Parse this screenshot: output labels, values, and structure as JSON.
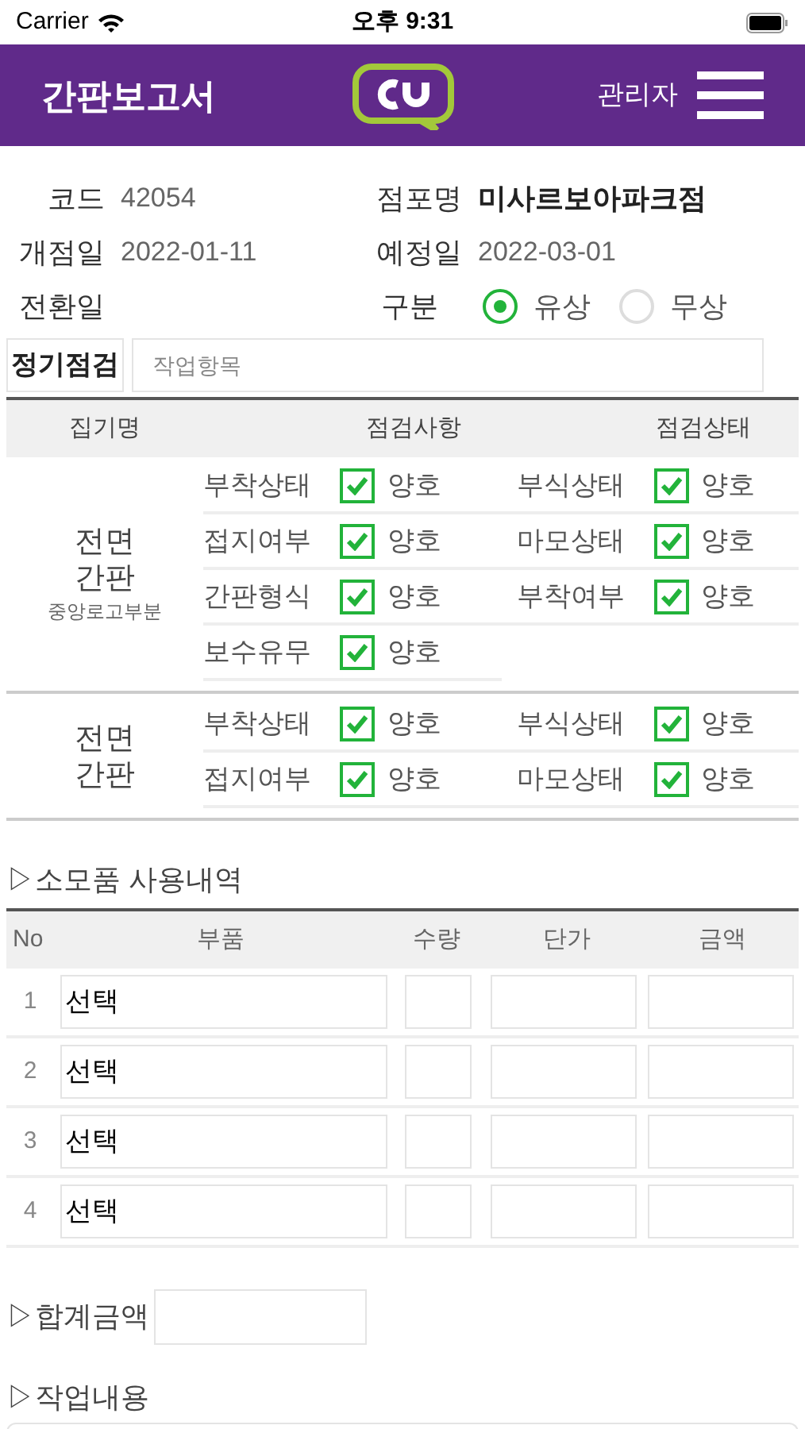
{
  "status_bar": {
    "carrier": "Carrier",
    "time": "오후 9:31"
  },
  "header": {
    "title": "간판보고서",
    "user": "관리자"
  },
  "info": {
    "code": {
      "label": "코드",
      "value": "42054"
    },
    "store": {
      "label": "점포명",
      "value": "미사르보아파크점"
    },
    "open_date": {
      "label": "개점일",
      "value": "2022-01-11"
    },
    "planned_date": {
      "label": "예정일",
      "value": "2022-03-01"
    },
    "conversion_date": {
      "label": "전환일"
    },
    "type": {
      "label": "구분",
      "options": [
        {
          "label": "유상",
          "selected": true
        },
        {
          "label": "무상",
          "selected": false
        }
      ]
    }
  },
  "regular": {
    "button": "정기점검",
    "placeholder": "작업항목"
  },
  "inspection": {
    "columns": [
      "집기명",
      "점검사항",
      "점검상태"
    ],
    "groups": [
      {
        "name": "전면 간판",
        "sub": "중앙로고부분",
        "items": [
          {
            "label": "부착상태",
            "checked": true,
            "status": "양호"
          },
          {
            "label": "부식상태",
            "checked": true,
            "status": "양호"
          },
          {
            "label": "접지여부",
            "checked": true,
            "status": "양호"
          },
          {
            "label": "마모상태",
            "checked": true,
            "status": "양호"
          },
          {
            "label": "간판형식",
            "checked": true,
            "status": "양호"
          },
          {
            "label": "부착여부",
            "checked": true,
            "status": "양호"
          },
          {
            "label": "보수유무",
            "checked": true,
            "status": "양호"
          }
        ]
      },
      {
        "name": "전면 간판",
        "items": [
          {
            "label": "부착상태",
            "checked": true,
            "status": "양호"
          },
          {
            "label": "부식상태",
            "checked": true,
            "status": "양호"
          },
          {
            "label": "접지여부",
            "checked": true,
            "status": "양호"
          },
          {
            "label": "마모상태",
            "checked": true,
            "status": "양호"
          }
        ]
      }
    ]
  },
  "parts": {
    "title": "▷소모품 사용내역",
    "columns": [
      "No",
      "부품",
      "수량",
      "단가",
      "금액"
    ],
    "rows": [
      {
        "no": "1",
        "part": "선택"
      },
      {
        "no": "2",
        "part": "선택"
      },
      {
        "no": "3",
        "part": "선택"
      },
      {
        "no": "4",
        "part": "선택"
      }
    ]
  },
  "total": {
    "label": "▷합계금액"
  },
  "work": {
    "label": "▷작업내용"
  }
}
